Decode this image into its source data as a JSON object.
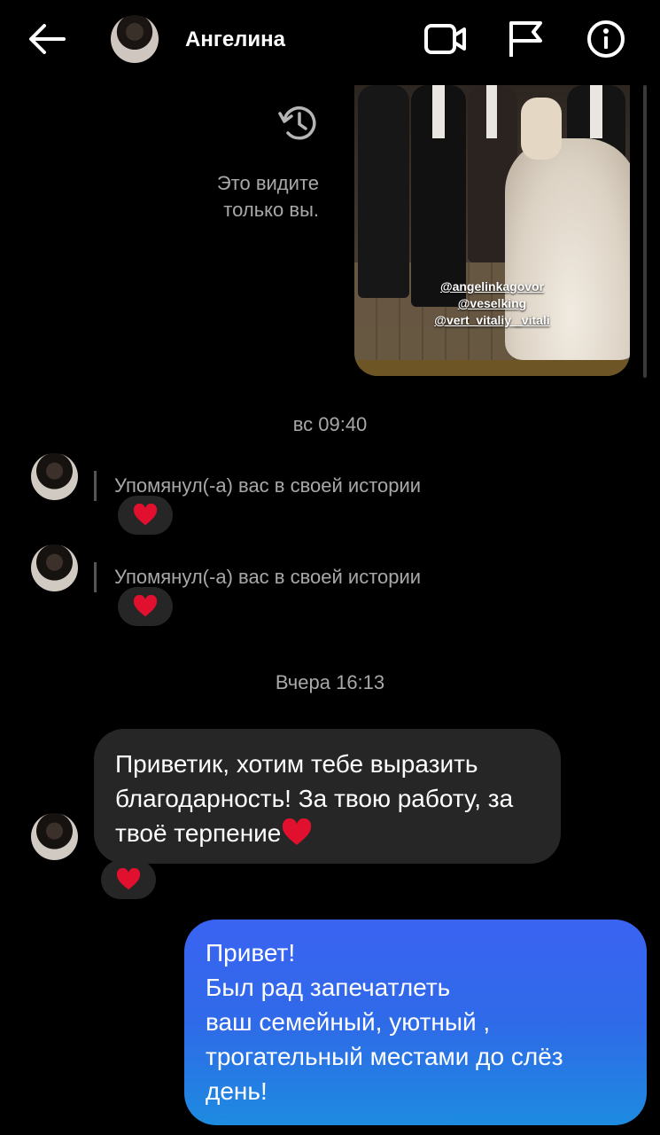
{
  "header": {
    "contact_name": "Ангелина",
    "icons": [
      "back-arrow-icon",
      "video-call-icon",
      "flag-icon",
      "info-icon"
    ]
  },
  "story_reply": {
    "note": "Это видите только вы.",
    "note_icon": "history-icon",
    "tags": [
      "@angelinkagovor",
      "@veselking",
      "@vert_vitaliy _vitali"
    ]
  },
  "messages": {
    "timestamp_1": "вс 09:40",
    "mention_1": "Упомянул(-а) вас в своей истории",
    "mention_2": "Упомянул(-а) вас в своей истории",
    "timestamp_2": "Вчера 16:13",
    "incoming_text": "Приветик, хотим тебе выразить благодарность! За твою работу, за твоё терпение",
    "outgoing_text": "Привет!\nБыл рад запечатлеть\nваш семейный, уютный ,\nтрогательный местами до слёз\nдень!"
  },
  "colors": {
    "background": "#000000",
    "incoming_bubble": "#262626",
    "outgoing_bubble_top": "#3a63f2",
    "outgoing_bubble_bottom": "#1d8be0",
    "heart": "#e0102e",
    "secondary_text": "#a8a8a8"
  }
}
